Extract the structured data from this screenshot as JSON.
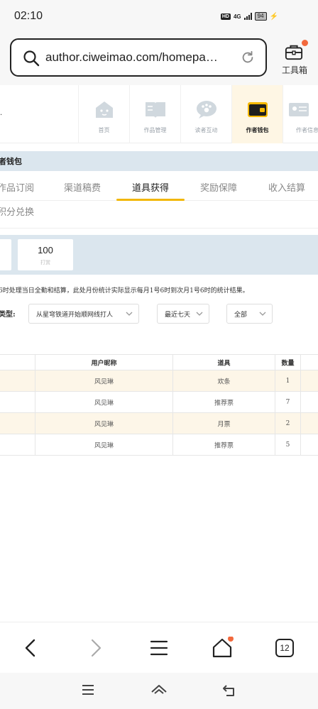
{
  "status": {
    "time": "02:10",
    "hd": "HD",
    "network": "4G",
    "battery": "94"
  },
  "browser": {
    "url": "author.ciweimao.com/homepa…",
    "toolbox_label": "工具箱",
    "tab_count": "12"
  },
  "nav": {
    "items": [
      {
        "label": "首页",
        "icon": "home-icon"
      },
      {
        "label": "作品管理",
        "icon": "book-icon"
      },
      {
        "label": "读者互动",
        "icon": "chat-paw-icon"
      },
      {
        "label": "作者钱包",
        "icon": "wallet-icon"
      },
      {
        "label": "作者信息",
        "icon": "id-card-icon"
      }
    ],
    "active_index": 3
  },
  "wallet": {
    "title": "者钱包"
  },
  "tabs": {
    "row1": [
      "作品订阅",
      "渠道稿费",
      "道具获得",
      "奖励保障",
      "收入结算"
    ],
    "row2": [
      "积分兑换"
    ],
    "active": "道具获得"
  },
  "stats": {
    "cards": [
      {
        "value": "100",
        "label": "打赏"
      }
    ]
  },
  "notice": "6时处理当日全勤和结算，此处月份统计实际显示每月1号6时到次月1号6时的统计结果。",
  "filters": {
    "label": "类型:",
    "source": "从星穹铁道开始顺网线打人",
    "period": "最近七天",
    "type": "全部"
  },
  "table": {
    "headers": [
      "用户昵称",
      "道具",
      "数量"
    ],
    "rows": [
      {
        "user": "风见琳",
        "item": "欢条",
        "count": "1"
      },
      {
        "user": "风见琳",
        "item": "推荐票",
        "count": "7"
      },
      {
        "user": "风见琳",
        "item": "月票",
        "count": "2"
      },
      {
        "user": "风见琳",
        "item": "推荐票",
        "count": "5"
      }
    ]
  },
  "colors": {
    "accent": "#f2b705",
    "band": "#dbe6ee",
    "row_alt": "#fdf6e8",
    "notify": "#f2693d"
  }
}
